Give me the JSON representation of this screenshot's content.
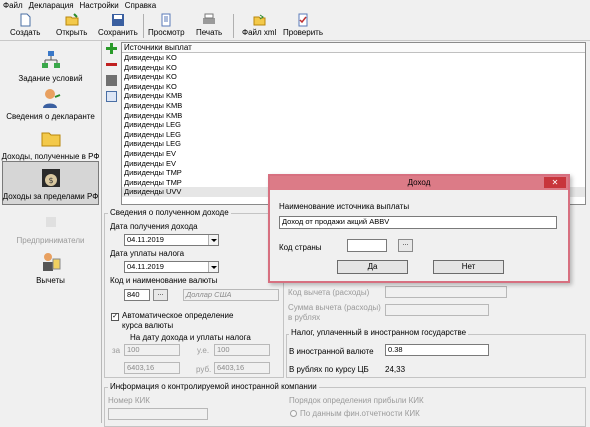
{
  "menu": [
    "Файл",
    "Декларация",
    "Настройки",
    "Справка"
  ],
  "toolbar": {
    "create": "Создать",
    "open": "Открыть",
    "save": "Сохранить",
    "preview": "Просмотр",
    "print": "Печать",
    "xml": "Файл xml",
    "check": "Проверить"
  },
  "sidebar": {
    "conditions": "Задание условий",
    "declarant": "Сведения о декларанте",
    "income_rf": "Доходы, полученные в РФ",
    "income_abroad": "Доходы за пределами РФ",
    "entrepreneurs": "Предприниматели",
    "deductions": "Вычеты"
  },
  "list": {
    "header": "Источники выплат",
    "rows": [
      "Дивиденды KO",
      "Дивиденды KO",
      "Дивиденды KO",
      "Дивиденды KO",
      "Дивиденды KMB",
      "Дивиденды KMB",
      "Дивиденды KMB",
      "Дивиденды LEG",
      "Дивиденды LEG",
      "Дивиденды LEG",
      "Дивиденды EV",
      "Дивиденды EV",
      "Дивиденды TMP",
      "Дивиденды TMP",
      "Дивиденды UVV"
    ]
  },
  "income": {
    "group_title": "Сведения о полученном доходе",
    "date_received_label": "Дата получения дохода",
    "date_received": "04.11.2019",
    "date_tax_label": "Дата уплаты налога",
    "date_tax": "04.11.2019",
    "currency_label": "Код и наименование валюты",
    "currency_code": "840",
    "currency_name": "Доллар США",
    "auto_rate_label": "Автоматическое определение курса валюты",
    "auto_rate_check": "✓",
    "rate_date_label": "На дату дохода и уплаты налога",
    "za": "за",
    "ue": "у.е.",
    "rub": "руб.",
    "za_value": "100",
    "ue_value": "100",
    "rub_value1": "6403,16",
    "rub_value2": "6403,16"
  },
  "deduction": {
    "code_label": "Код вычета (расходы)",
    "sum_label": "Сумма вычета (расходы)",
    "sum_unit": "в рублях"
  },
  "tax": {
    "group_title": "Налог, уплаченный в иностранном государстве",
    "foreign_label": "В иностранной валюте",
    "foreign_value": "0.38",
    "rub_label": "В рублях по курсу ЦБ",
    "rub_value": "24,33"
  },
  "cfc": {
    "group_title": "Информация о контролируемой иностранной компании",
    "number_label": "Номер КИК",
    "profit_label": "Порядок определения прибыли КИК",
    "radio_label": "По данным фин.отчетности КИК"
  },
  "dialog": {
    "title": "Доход",
    "close": "✕",
    "name_label": "Наименование источника выплаты",
    "name_value": "Доход от продажи акций ABBV",
    "country_label": "Код страны",
    "browse": "...",
    "yes": "Да",
    "no": "Нет"
  }
}
